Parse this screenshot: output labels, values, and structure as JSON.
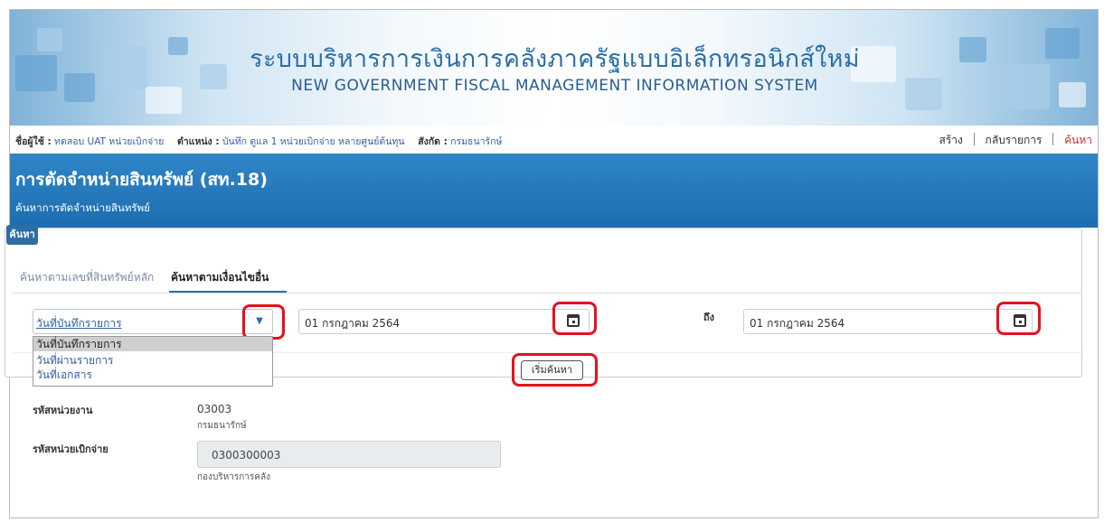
{
  "header": {
    "title_th": "ระบบบริหารการเงินการคลังภาครัฐแบบอิเล็กทรอนิกส์ใหม่",
    "title_en": "NEW GOVERNMENT FISCAL MANAGEMENT INFORMATION SYSTEM"
  },
  "user": {
    "name_label": "ชื่อผู้ใช้ :",
    "name": "ทดสอบ UAT หน่วยเบิกจ่าย",
    "position_label": "ตำแหน่ง :",
    "position": "บันทึก ดูแล 1 หน่วยเบิกจ่าย หลายศูนย์ต้นทุน",
    "affiliation_label": "สังกัด :",
    "affiliation": "กรมธนารักษ์"
  },
  "toplinks": {
    "create": "สร้าง",
    "back": "กลับรายการ",
    "search": "ค้นหา"
  },
  "page": {
    "title": "การตัดจำหน่ายสินทรัพย์ (สท.18)",
    "subtitle": "ค้นหาการตัดจำหน่ายสินทรัพย์"
  },
  "search": {
    "badge": "ค้นหา",
    "tabs": [
      "ค้นหาตามเลขที่สินทรัพย์หลัก",
      "ค้นหาตามเงื่อนไขอื่น"
    ],
    "date_type_selected": "วันที่บันทึกรายการ",
    "date_type_options": [
      "วันที่บันทึกรายการ",
      "วันที่ผ่านรายการ",
      "วันที่เอกสาร"
    ],
    "from_date": "01 กรกฎาคม 2564",
    "to_label": "ถึง",
    "to_date": "01 กรกฎาคม 2564",
    "search_button": "เริ่มค้นหา"
  },
  "details": {
    "dept_code_label": "รหัสหน่วยงาน",
    "dept_code": "03003",
    "dept_name": "กรมธนารักษ์",
    "disb_code_label": "รหัสหน่วยเบิกจ่าย",
    "disb_code": "0300300003",
    "disb_name": "กองบริหารการคลัง"
  },
  "colors": {
    "header_blue": "#1d6db0",
    "highlight_red": "#e3121e",
    "link_blue": "#2f5fa5"
  }
}
